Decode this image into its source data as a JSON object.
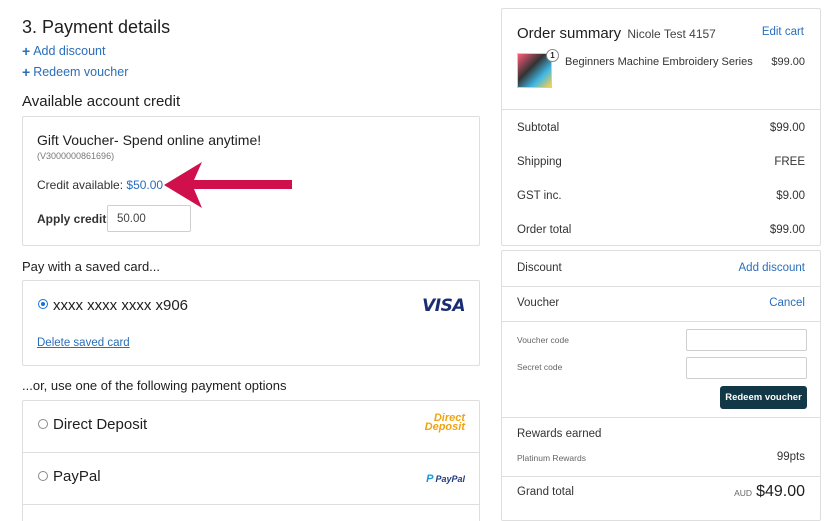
{
  "left": {
    "section_title": "3. Payment details",
    "add_discount": "Add discount",
    "redeem_voucher": "Redeem voucher",
    "available_credit_heading": "Available account credit",
    "credit": {
      "title": "Gift Voucher- Spend online anytime!",
      "code": "(V3000000861696)",
      "credit_label": "Credit available:",
      "credit_amount": "$50.00",
      "apply_label": "Apply credit",
      "apply_value": "50.00"
    },
    "saved_card_heading": "Pay with a saved card...",
    "saved_card": {
      "number": "xxxx xxxx xxxx x906",
      "brand": "VISA",
      "delete_label": "Delete saved card"
    },
    "options_heading": "...or, use one of the following payment options",
    "options": [
      {
        "label": "Direct Deposit",
        "logo_line1": "Direct",
        "logo_line2": "Deposit"
      },
      {
        "label": "PayPal",
        "logo": "PayPal"
      }
    ]
  },
  "summary": {
    "title": "Order summary",
    "user": "Nicole Test 4157",
    "edit_cart": "Edit cart",
    "item": {
      "quantity": "1",
      "name": "Beginners Machine Embroidery Series",
      "price": "$99.00"
    },
    "rows": [
      {
        "label": "Subtotal",
        "value": "$99.00"
      },
      {
        "label": "Shipping",
        "value": "FREE"
      },
      {
        "label": "GST inc.",
        "value": "$9.00"
      },
      {
        "label": "Order total",
        "value": "$99.00"
      }
    ]
  },
  "discounts": {
    "discount_label": "Discount",
    "add_discount": "Add discount",
    "voucher_label": "Voucher",
    "cancel": "Cancel",
    "voucher_code_label": "Voucher code",
    "secret_code_label": "Secret code",
    "redeem_button": "Redeem voucher",
    "rewards_label": "Rewards earned",
    "rewards_tier": "Platinum Rewards",
    "rewards_points": "99pts",
    "grand_total_label": "Grand total",
    "currency": "AUD",
    "grand_total": "$49.00"
  },
  "colors": {
    "link": "#2a6ebb",
    "arrow": "#d0104c",
    "button_bg": "#123847"
  }
}
